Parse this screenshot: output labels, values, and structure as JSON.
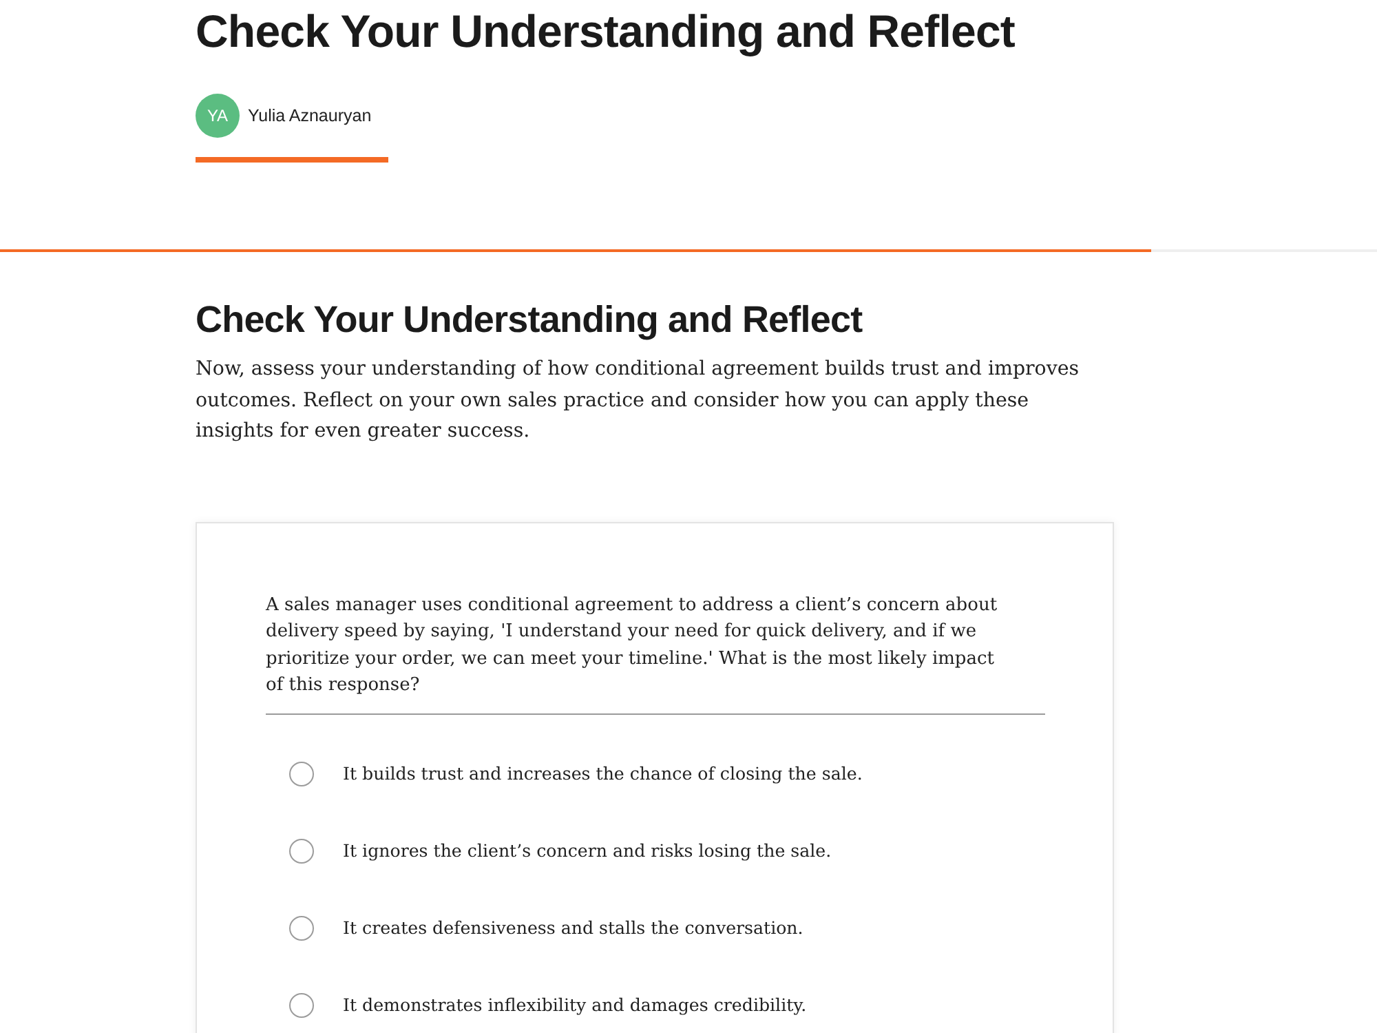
{
  "lesson": {
    "title": "Check Your Understanding and Reflect",
    "author": {
      "initials": "YA",
      "name": "Yulia Aznauryan"
    }
  },
  "progress": {
    "level": 0.836
  },
  "section": {
    "heading": "Check Your Understanding and Reflect",
    "intro": "Now, assess your understanding of how conditional agreement builds trust and improves outcomes. Reflect on your own sales practice and consider how you can apply these insights for even greater success."
  },
  "question": {
    "prompt": "A sales manager uses conditional agreement to address a client’s concern about delivery speed by saying, 'I understand your need for quick delivery, and if we prioritize your order, we can meet your timeline.' What is the most likely impact of this response?",
    "options": [
      {
        "label": "It builds trust and increases the chance of closing the sale.",
        "selected": false
      },
      {
        "label": "It ignores the client’s concern and risks losing the sale.",
        "selected": false
      },
      {
        "label": "It creates defensiveness and stalls the conversation.",
        "selected": false
      },
      {
        "label": "It demonstrates inflexibility and damages credibility.",
        "selected": false
      }
    ]
  }
}
